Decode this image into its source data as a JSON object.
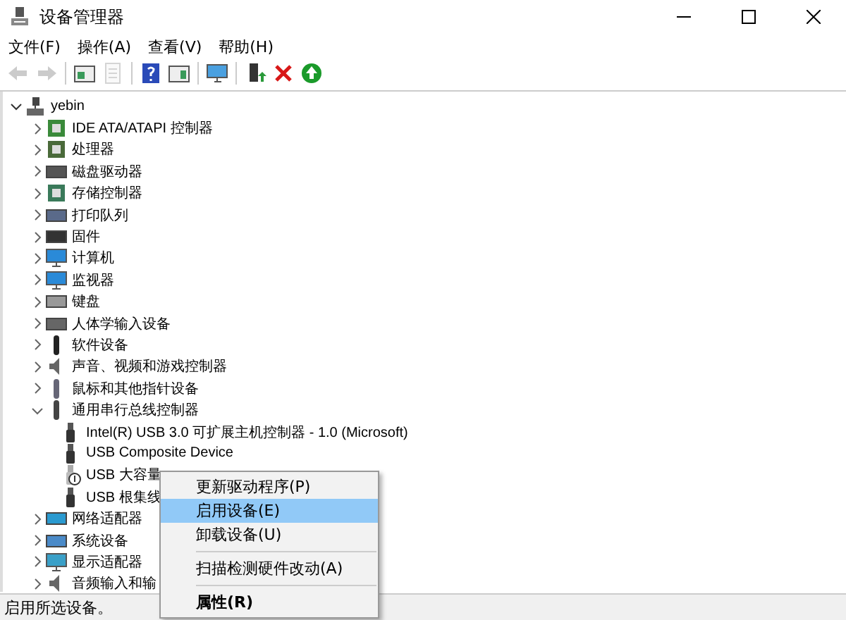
{
  "window": {
    "title": "设备管理器"
  },
  "menu_bar": [
    "文件(F)",
    "操作(A)",
    "查看(V)",
    "帮助(H)"
  ],
  "toolbar": [
    {
      "disabled": true
    },
    {
      "disabled": true
    },
    {
      "disabled": false
    },
    {
      "disabled": true
    },
    {
      "disabled": false
    },
    {
      "disabled": false
    },
    {
      "disabled": false
    },
    {
      "disabled": false
    },
    {
      "disabled": false
    },
    {
      "disabled": false
    }
  ],
  "tree": {
    "label": "yebin",
    "expanded": true,
    "children": [
      {
        "label": "IDE ATA/ATAPI 控制器",
        "expanded": false
      },
      {
        "label": "处理器",
        "expanded": false
      },
      {
        "label": "磁盘驱动器",
        "expanded": false
      },
      {
        "label": "存储控制器",
        "expanded": false
      },
      {
        "label": "打印队列",
        "expanded": false
      },
      {
        "label": "固件",
        "expanded": false
      },
      {
        "label": "计算机",
        "expanded": false
      },
      {
        "label": "监视器",
        "expanded": false
      },
      {
        "label": "键盘",
        "expanded": false
      },
      {
        "label": "人体学输入设备",
        "expanded": false
      },
      {
        "label": "软件设备",
        "expanded": false
      },
      {
        "label": "声音、视频和游戏控制器",
        "expanded": false
      },
      {
        "label": "鼠标和其他指针设备",
        "expanded": false
      },
      {
        "label": "通用串行总线控制器",
        "expanded": true,
        "children": [
          {
            "label": "Intel(R) USB 3.0 可扩展主机控制器 - 1.0 (Microsoft)",
            "disabled": false
          },
          {
            "label": "USB Composite Device",
            "disabled": false
          },
          {
            "label": "USB 大容量",
            "disabled": true
          },
          {
            "label": "USB 根集线",
            "disabled": false
          }
        ]
      },
      {
        "label": "网络适配器",
        "expanded": false
      },
      {
        "label": "系统设备",
        "expanded": false
      },
      {
        "label": "显示适配器",
        "expanded": false
      },
      {
        "label": "音频输入和输",
        "expanded": false
      }
    ]
  },
  "context_menu": [
    {
      "kind": "item",
      "label": "更新驱动程序(P)",
      "selected": false,
      "default": false
    },
    {
      "kind": "item",
      "label": "启用设备(E)",
      "selected": true,
      "default": false
    },
    {
      "kind": "item",
      "label": "卸载设备(U)",
      "selected": false,
      "default": false
    },
    {
      "kind": "separator"
    },
    {
      "kind": "item",
      "label": "扫描检测硬件改动(A)",
      "selected": false,
      "default": false
    },
    {
      "kind": "separator"
    },
    {
      "kind": "item",
      "label": "属性(R)",
      "selected": false,
      "default": true
    }
  ],
  "status_bar": "启用所选设备。"
}
